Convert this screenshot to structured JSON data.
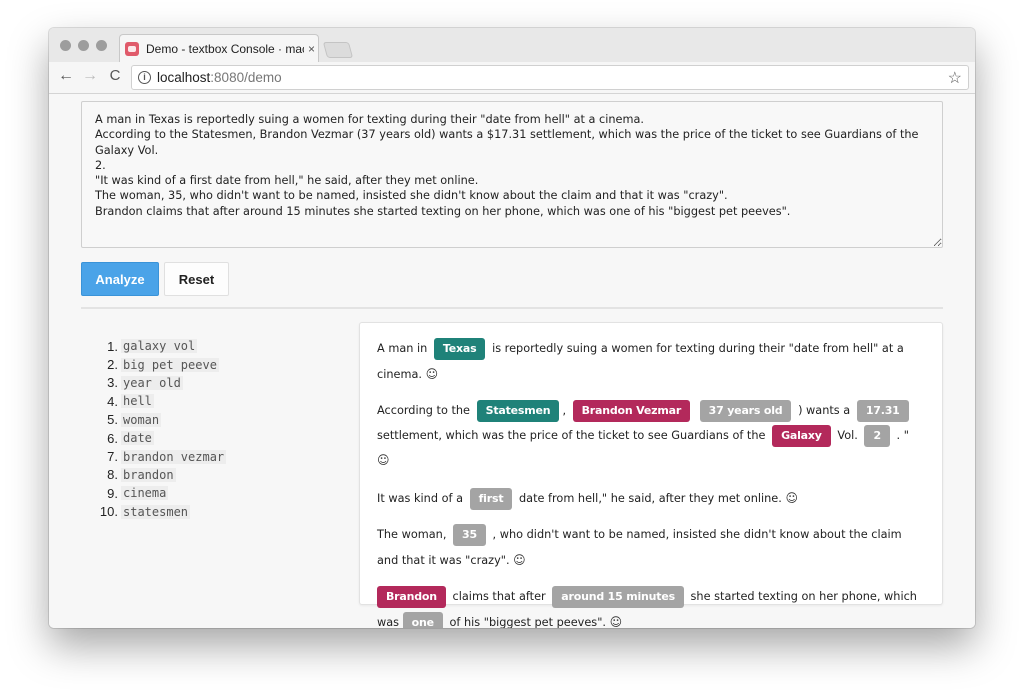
{
  "browser": {
    "tab_title": "Demo - textbox Console · mac",
    "tab_close": "×",
    "url_host": "localhost",
    "url_rest": ":8080/demo",
    "back_icon": "←",
    "forward_icon": "→",
    "reload_icon": "C",
    "info_icon": "i",
    "star_icon": "☆"
  },
  "input": {
    "text": "A man in Texas is reportedly suing a women for texting during their \"date from hell\" at a cinema.\nAccording to the Statesmen, Brandon Vezmar (37 years old) wants a $17.31 settlement, which was the price of the ticket to see Guardians of the Galaxy Vol.\n2.\n\"It was kind of a first date from hell,\" he said, after they met online.\nThe woman, 35, who didn't want to be named, insisted she didn't know about the claim and that it was \"crazy\".\nBrandon claims that after around 15 minutes she started texting on her phone, which was one of his \"biggest pet peeves\"."
  },
  "buttons": {
    "analyze": "Analyze",
    "reset": "Reset"
  },
  "keywords": [
    {
      "num": "1.",
      "text": "galaxy vol"
    },
    {
      "num": "2.",
      "text": "big pet peeve"
    },
    {
      "num": "3.",
      "text": "year old"
    },
    {
      "num": "4.",
      "text": "hell"
    },
    {
      "num": "5.",
      "text": "woman"
    },
    {
      "num": "6.",
      "text": "date"
    },
    {
      "num": "7.",
      "text": "brandon vezmar"
    },
    {
      "num": "8.",
      "text": "brandon"
    },
    {
      "num": "9.",
      "text": "cinema"
    },
    {
      "num": "10.",
      "text": "statesmen"
    }
  ],
  "results": {
    "entity_colors": {
      "location": "#1f8279",
      "person": "#b3295b",
      "number": "#a4a4a4"
    },
    "smile": "☺",
    "p1": {
      "t1": "A man in",
      "e1": "Texas",
      "t2": "is reportedly suing a women for texting during their \"date from hell\" at a cinema."
    },
    "p2": {
      "t1": "According to the",
      "e1": "Statesmen",
      "t2": ",",
      "e2": "Brandon Vezmar",
      "e3": "37 years old",
      "t3": ") wants a",
      "e4": "17.31",
      "t4": "settlement, which was the price of the ticket to see Guardians of the",
      "e5": "Galaxy",
      "t5": "Vol.",
      "e6": "2",
      "t6": ". \""
    },
    "p3": {
      "t1": "It was kind of a",
      "e1": "first",
      "t2": "date from hell,\" he said, after they met online."
    },
    "p4": {
      "t1": "The woman,",
      "e1": "35",
      "t2": ", who didn't want to be named, insisted she didn't know about the claim and that it was \"crazy\"."
    },
    "p5": {
      "e1": "Brandon",
      "t1": "claims that after",
      "e2": "around 15 minutes",
      "t2": "she started texting on her phone, which was",
      "e3": "one",
      "t3": "of his \"biggest pet peeves\"."
    }
  }
}
